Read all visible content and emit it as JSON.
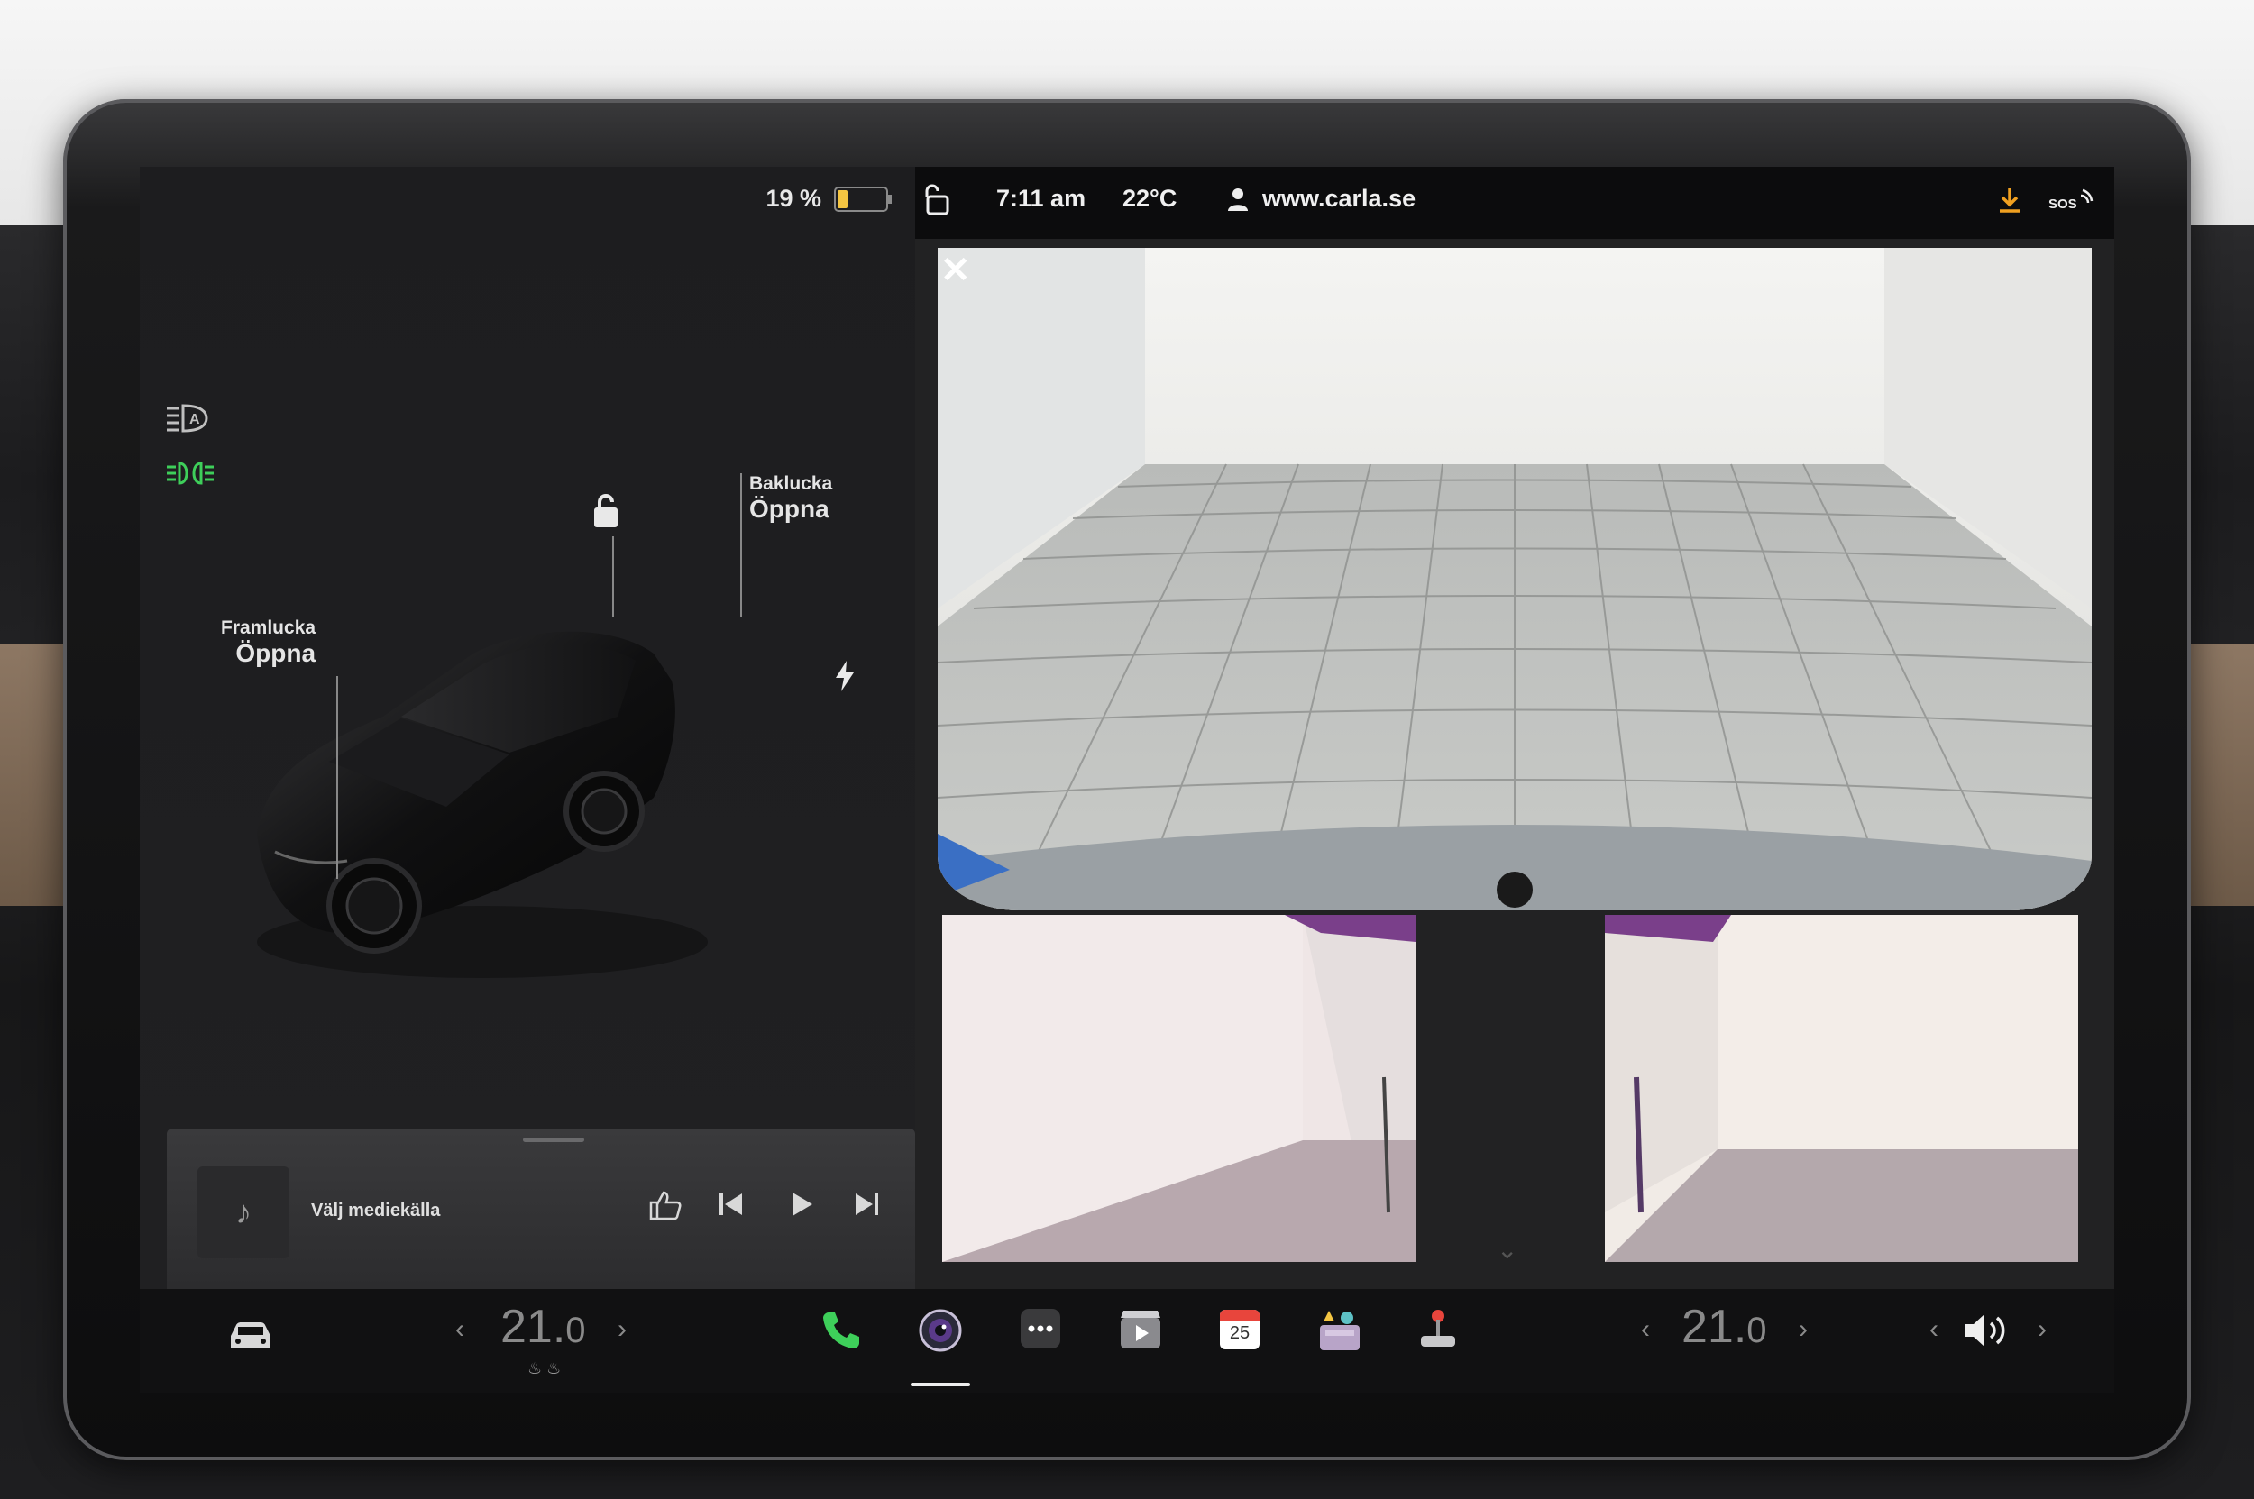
{
  "status": {
    "battery_percent": "19 %",
    "battery_level": 0.19,
    "time": "7:11 am",
    "temperature": "22°C",
    "profile": "www.carla.se"
  },
  "car": {
    "front_trunk_label": "Framlucka",
    "front_trunk_action": "Öppna",
    "rear_trunk_label": "Baklucka",
    "rear_trunk_action": "Öppna"
  },
  "media": {
    "source_label": "Välj mediekälla"
  },
  "dock": {
    "driver_temp_main": "21.",
    "driver_temp_decimal": "0",
    "passenger_temp_main": "21.",
    "passenger_temp_decimal": "0",
    "calendar_day": "25"
  },
  "colors": {
    "accent_green": "#3ecf5a",
    "download_orange": "#f0a020",
    "battery_yellow": "#f4c542"
  },
  "icons": [
    "headlight-auto-icon",
    "parking-lights-icon",
    "unlock-icon",
    "bolt-icon",
    "music-note-icon",
    "thumbs-up-icon",
    "previous-icon",
    "play-icon",
    "next-icon",
    "lock-open-icon",
    "user-icon",
    "download-icon",
    "sos-icon",
    "close-icon",
    "car-icon",
    "seat-heater-icon",
    "phone-icon",
    "camera-icon",
    "more-icon",
    "theater-icon",
    "calendar-icon",
    "toybox-icon",
    "joystick-icon",
    "volume-icon"
  ]
}
